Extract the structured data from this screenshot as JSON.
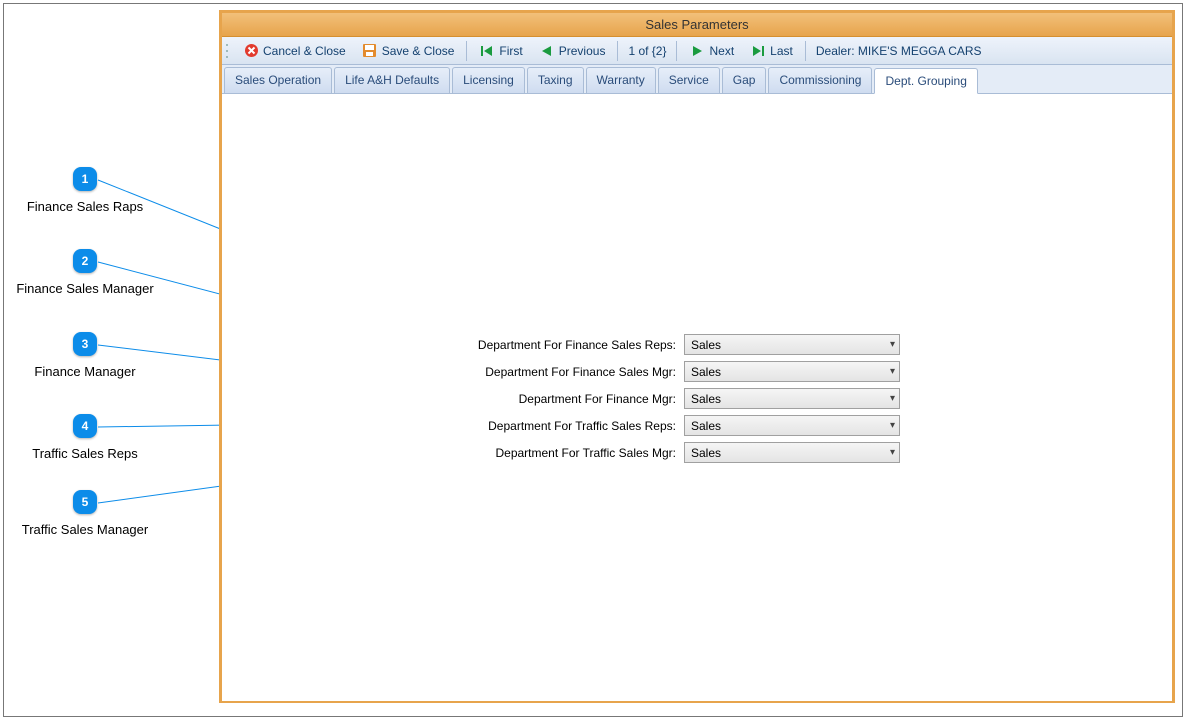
{
  "window": {
    "title": "Sales Parameters"
  },
  "toolbar": {
    "cancel_close": "Cancel & Close",
    "save_close": "Save & Close",
    "first": "First",
    "previous": "Previous",
    "pager": "1 of {2}",
    "next": "Next",
    "last": "Last",
    "dealer_label": "Dealer: MIKE'S MEGGA CARS"
  },
  "tabs": [
    "Sales Operation",
    "Life A&H Defaults",
    "Licensing",
    "Taxing",
    "Warranty",
    "Service",
    "Gap",
    "Commissioning",
    "Dept. Grouping"
  ],
  "active_tab_index": 8,
  "form": {
    "rows": [
      {
        "label": "Department For Finance Sales Reps:",
        "value": "Sales"
      },
      {
        "label": "Department For Finance Sales Mgr:",
        "value": "Sales"
      },
      {
        "label": "Department For Finance Mgr:",
        "value": "Sales"
      },
      {
        "label": "Department For Traffic Sales Reps:",
        "value": "Sales"
      },
      {
        "label": "Department For Traffic Sales Mgr:",
        "value": "Sales"
      }
    ]
  },
  "callouts": [
    {
      "num": "1",
      "label": "Finance Sales Raps"
    },
    {
      "num": "2",
      "label": "Finance Sales Manager"
    },
    {
      "num": "3",
      "label": "Finance Manager"
    },
    {
      "num": "4",
      "label": "Traffic Sales Reps"
    },
    {
      "num": "5",
      "label": "Traffic Sales Manager"
    }
  ]
}
